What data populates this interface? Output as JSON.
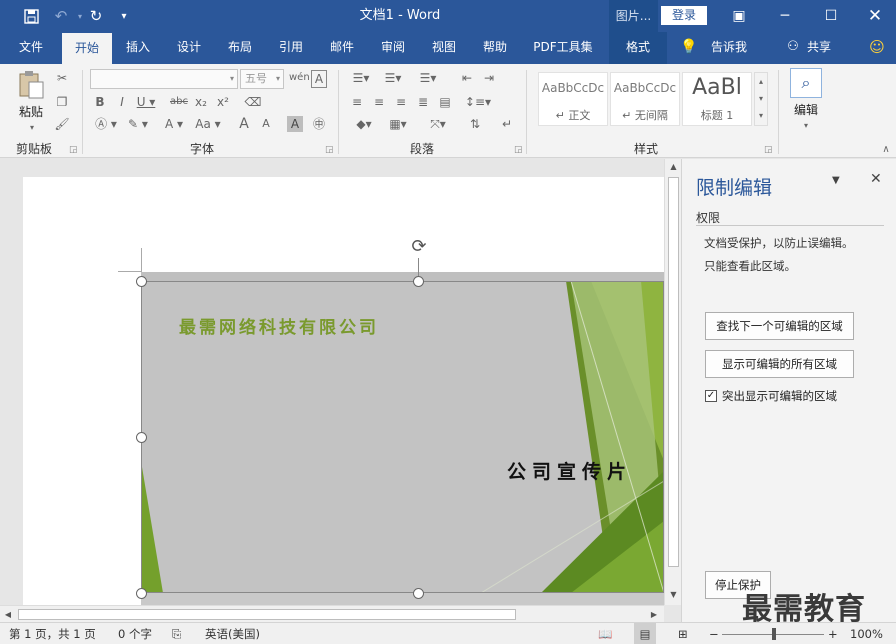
{
  "titlebar": {
    "title": "文档1  -  Word",
    "context_tab": "图片...",
    "login_label": "登录",
    "colors": {
      "brand": "#2b579a"
    }
  },
  "tabs": {
    "file": "文件",
    "home": "开始",
    "insert": "插入",
    "design": "设计",
    "layout": "布局",
    "references": "引用",
    "mailings": "邮件",
    "review": "审阅",
    "view": "视图",
    "help": "帮助",
    "pdf": "PDF工具集",
    "format": "格式",
    "tell_me": "告诉我",
    "share": "共享"
  },
  "ribbon": {
    "clipboard": {
      "paste_label": "粘贴",
      "group_label": "剪贴板"
    },
    "font": {
      "font_name_value": "",
      "font_size_value": "五号",
      "group_label": "字体"
    },
    "paragraph": {
      "group_label": "段落"
    },
    "styles": {
      "group_label": "样式",
      "items": [
        {
          "sample": "AaBbCcDc",
          "name": "↵ 正文"
        },
        {
          "sample": "AaBbCcDc",
          "name": "↵ 无间隔"
        },
        {
          "sample": "AaBl",
          "name": "标题 1"
        }
      ]
    },
    "editing": {
      "label": "编辑"
    }
  },
  "document": {
    "company_name": "最需网络科技有限公司",
    "slogan": "公司宣传片"
  },
  "pane": {
    "title": "限制编辑",
    "section": "权限",
    "info_line1": "文档受保护，以防止误编辑。",
    "info_line2": "只能查看此区域。",
    "find_next_label": "查找下一个可编辑的区域",
    "show_all_label": "显示可编辑的所有区域",
    "highlight_label": "突出显示可编辑的区域",
    "highlight_checked": true,
    "stop_label": "停止保护"
  },
  "watermark": "最需教育",
  "statusbar": {
    "page": "第 1 页，共 1 页",
    "words": "0 个字",
    "language": "英语(美国)",
    "zoom": "100%"
  }
}
